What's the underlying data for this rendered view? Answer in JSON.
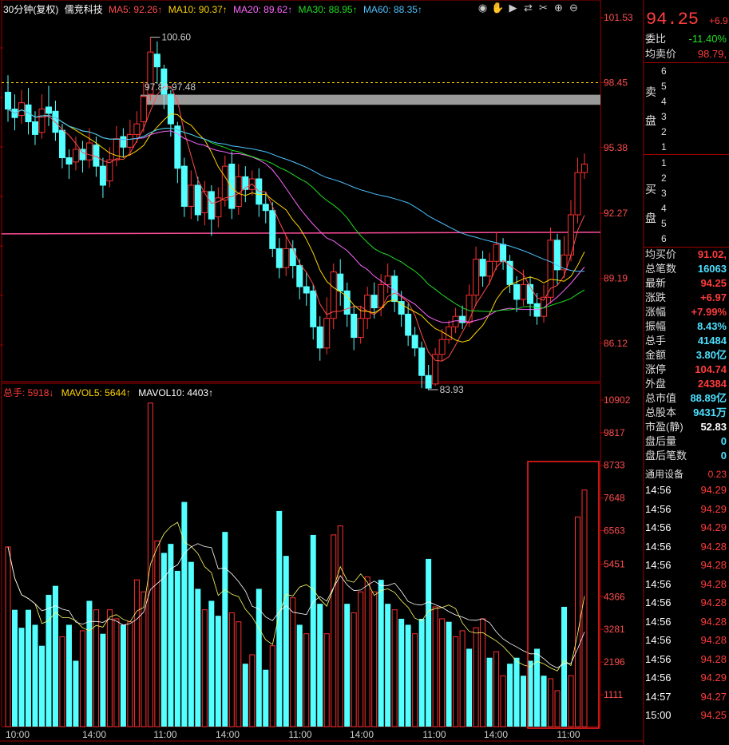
{
  "header": {
    "period": "30分钟(复权)",
    "stock": "儒竞科技",
    "ma": [
      {
        "label": "MA5: 92.26↑",
        "color": "#ff4d4d"
      },
      {
        "label": "MA10: 90.37↑",
        "color": "#ffd400"
      },
      {
        "label": "MA20: 89.62↑",
        "color": "#ff66ff"
      },
      {
        "label": "MA30: 88.95↑",
        "color": "#22dd22"
      },
      {
        "label": "MA60: 88.35↑",
        "color": "#4dc3ff"
      }
    ]
  },
  "toolbar": [
    "eye-icon",
    "hand-icon",
    "play-icon",
    "shuffle-icon",
    "tools-icon",
    "zoom-in-icon",
    "zoom-out-icon"
  ],
  "volume_header": {
    "zongshou": "总手: 5918↓",
    "mavol5": "MAVOL5: 5644↑",
    "mavol10": "MAVOL10: 4403↑"
  },
  "side": {
    "price": "94.25",
    "change_short": "+6.9",
    "weibi_label": "委比",
    "weibi": "-11.40%",
    "jmj_label": "均卖价",
    "jmj": "98.79,",
    "sell_label": "卖盘",
    "sell_levels": [
      "6",
      "5",
      "4",
      "3",
      "2",
      "1"
    ],
    "buy_label": "买盘",
    "buy_levels": [
      "1",
      "2",
      "3",
      "4",
      "5",
      "6"
    ],
    "stats": [
      {
        "k": "均买价",
        "v": "91.02,",
        "c": "red"
      },
      {
        "k": "总笔数",
        "v": "16063",
        "c": "cyan"
      },
      {
        "k": "最新",
        "v": "94.25",
        "c": "red"
      },
      {
        "k": "涨跌",
        "v": "+6.97",
        "c": "red"
      },
      {
        "k": "涨幅",
        "v": "+7.99%",
        "c": "red"
      },
      {
        "k": "振幅",
        "v": "8.43%",
        "c": "cyan"
      },
      {
        "k": "总手",
        "v": "41484",
        "c": "cyan"
      },
      {
        "k": "金额",
        "v": "3.80亿",
        "c": "cyan"
      },
      {
        "k": "涨停",
        "v": "104.74",
        "c": "red"
      },
      {
        "k": "外盘",
        "v": "24384",
        "c": "red"
      },
      {
        "k": "总市值",
        "v": "88.89亿",
        "c": "cyan"
      },
      {
        "k": "总股本",
        "v": "9431万",
        "c": "cyan"
      },
      {
        "k": "市盈(静)",
        "v": "52.83",
        "c": "wht"
      },
      {
        "k": "盘后量",
        "v": "0",
        "c": "cyan"
      },
      {
        "k": "盘后笔数",
        "v": "0",
        "c": "cyan"
      }
    ],
    "device_label": "通用设备",
    "device_val": "0.23",
    "ticks": [
      {
        "t": "14:56",
        "p": "94.29"
      },
      {
        "t": "14:56",
        "p": "94.29"
      },
      {
        "t": "14:56",
        "p": "94.29"
      },
      {
        "t": "14:56",
        "p": "94.28"
      },
      {
        "t": "14:56",
        "p": "94.28"
      },
      {
        "t": "14:56",
        "p": "94.28"
      },
      {
        "t": "14:56",
        "p": "94.28"
      },
      {
        "t": "14:56",
        "p": "94.28"
      },
      {
        "t": "14:56",
        "p": "94.28"
      },
      {
        "t": "14:56",
        "p": "94.28"
      },
      {
        "t": "14:56",
        "p": "94.29"
      },
      {
        "t": "14:57",
        "p": "94.27"
      },
      {
        "t": "15:00",
        "p": "94.25"
      }
    ]
  },
  "chart_data": {
    "type": "candlestick",
    "price_ticks": [
      "101.53",
      "98.45",
      "95.38",
      "92.27",
      "89.19",
      "86.12"
    ],
    "price_tick_values": [
      101.53,
      98.45,
      95.38,
      92.27,
      89.19,
      86.12
    ],
    "vol_ticks": [
      "10902",
      "9817",
      "8733",
      "7648",
      "6563",
      "5451",
      "4366",
      "3281",
      "2196",
      "1111"
    ],
    "vol_tick_values": [
      10902,
      9817,
      8733,
      7648,
      6563,
      5451,
      4366,
      3281,
      2196,
      1111
    ],
    "x_labels": [
      "10:00",
      "14:00",
      "11:00",
      "14:00",
      "11:00",
      "14:00",
      "11:00",
      "14:00",
      "11:00"
    ],
    "annot_high": "100.60",
    "annot_low": "83.93",
    "annot_range": "97.88-97.48",
    "ref_dashed": 98.45,
    "ref_line": 91.3,
    "band": [
      97.48,
      97.88
    ],
    "candles": [
      [
        98.0,
        97.2,
        98.8,
        96.6
      ],
      [
        97.2,
        96.8,
        97.9,
        96.2
      ],
      [
        96.9,
        97.5,
        98.1,
        96.5
      ],
      [
        97.4,
        96.6,
        98.2,
        96.0
      ],
      [
        96.6,
        96.0,
        97.1,
        95.5
      ],
      [
        96.1,
        97.2,
        97.9,
        95.8
      ],
      [
        97.3,
        97.0,
        98.3,
        96.4
      ],
      [
        97.1,
        96.1,
        97.6,
        95.7
      ],
      [
        96.2,
        94.9,
        96.5,
        94.4
      ],
      [
        94.9,
        94.6,
        95.3,
        93.9
      ],
      [
        94.7,
        95.3,
        95.9,
        94.3
      ],
      [
        95.3,
        94.8,
        95.7,
        94.2
      ],
      [
        94.8,
        95.6,
        96.3,
        94.4
      ],
      [
        95.5,
        94.5,
        95.9,
        94.0
      ],
      [
        94.5,
        93.6,
        94.9,
        93.0
      ],
      [
        93.8,
        94.8,
        95.4,
        93.5
      ],
      [
        94.8,
        95.8,
        96.4,
        94.5
      ],
      [
        95.9,
        95.4,
        96.3,
        94.9
      ],
      [
        95.4,
        96.0,
        96.7,
        95.0
      ],
      [
        96.0,
        96.5,
        97.1,
        95.6
      ],
      [
        96.6,
        97.8,
        98.5,
        96.1
      ],
      [
        97.9,
        99.9,
        100.6,
        97.6
      ],
      [
        99.8,
        99.2,
        100.4,
        98.4
      ],
      [
        99.1,
        97.9,
        99.3,
        97.2
      ],
      [
        97.9,
        96.5,
        98.1,
        95.9
      ],
      [
        96.4,
        94.4,
        96.6,
        93.7
      ],
      [
        94.5,
        92.6,
        94.9,
        92.1
      ],
      [
        92.6,
        93.6,
        94.3,
        92.0
      ],
      [
        93.6,
        92.2,
        94.0,
        91.9
      ],
      [
        92.3,
        93.3,
        93.8,
        91.7
      ],
      [
        93.3,
        92.0,
        93.6,
        91.2
      ],
      [
        92.1,
        93.0,
        93.5,
        91.6
      ],
      [
        92.9,
        94.5,
        95.0,
        92.6
      ],
      [
        94.6,
        92.5,
        95.2,
        92.0
      ],
      [
        92.6,
        94.0,
        94.6,
        92.2
      ],
      [
        94.0,
        93.4,
        94.5,
        92.8
      ],
      [
        93.4,
        93.9,
        94.3,
        93.1
      ],
      [
        93.9,
        92.7,
        94.4,
        92.1
      ],
      [
        92.7,
        92.4,
        93.3,
        91.8
      ],
      [
        92.4,
        90.6,
        92.8,
        90.2
      ],
      [
        90.6,
        89.7,
        91.1,
        89.2
      ],
      [
        89.7,
        90.6,
        91.2,
        89.3
      ],
      [
        90.6,
        89.8,
        91.0,
        89.2
      ],
      [
        89.8,
        88.8,
        90.1,
        88.2
      ],
      [
        88.8,
        88.5,
        89.5,
        87.9
      ],
      [
        88.6,
        86.9,
        88.9,
        86.3
      ],
      [
        86.9,
        85.9,
        87.4,
        85.3
      ],
      [
        85.9,
        87.3,
        88.3,
        85.6
      ],
      [
        87.3,
        89.5,
        89.9,
        86.8
      ],
      [
        89.4,
        88.6,
        90.1,
        87.9
      ],
      [
        88.6,
        87.5,
        89.0,
        86.9
      ],
      [
        87.5,
        86.4,
        87.9,
        85.8
      ],
      [
        86.4,
        87.3,
        87.9,
        86.1
      ],
      [
        87.3,
        88.4,
        88.8,
        86.8
      ],
      [
        88.4,
        87.8,
        89.0,
        87.3
      ],
      [
        87.8,
        88.9,
        89.4,
        87.4
      ],
      [
        88.9,
        89.3,
        89.9,
        88.5
      ],
      [
        89.3,
        88.1,
        89.6,
        87.6
      ],
      [
        88.1,
        87.5,
        88.6,
        86.9
      ],
      [
        87.5,
        86.5,
        88.0,
        86.0
      ],
      [
        86.5,
        85.9,
        86.9,
        85.5
      ],
      [
        85.9,
        84.6,
        86.2,
        84.0
      ],
      [
        84.6,
        84.0,
        85.1,
        83.9
      ],
      [
        84.2,
        85.6,
        85.9,
        84.1
      ],
      [
        85.6,
        86.3,
        86.8,
        85.3
      ],
      [
        86.3,
        86.9,
        87.2,
        86.1
      ],
      [
        86.9,
        87.4,
        87.8,
        86.6
      ],
      [
        87.4,
        87.1,
        87.9,
        86.8
      ],
      [
        87.1,
        88.4,
        88.9,
        86.9
      ],
      [
        88.4,
        90.1,
        90.7,
        87.9
      ],
      [
        90.1,
        89.3,
        90.5,
        88.8
      ],
      [
        89.3,
        90.0,
        90.4,
        88.9
      ],
      [
        90.0,
        90.8,
        91.4,
        89.6
      ],
      [
        90.8,
        90.0,
        91.1,
        89.6
      ],
      [
        90.0,
        88.9,
        90.3,
        88.5
      ],
      [
        88.9,
        88.2,
        89.3,
        87.6
      ],
      [
        88.2,
        88.9,
        89.6,
        87.9
      ],
      [
        88.9,
        88.0,
        89.3,
        87.4
      ],
      [
        88.0,
        87.4,
        88.5,
        87.0
      ],
      [
        87.4,
        88.3,
        88.9,
        87.1
      ],
      [
        88.3,
        91.0,
        91.6,
        88.0
      ],
      [
        91.0,
        89.6,
        91.3,
        88.9
      ],
      [
        89.6,
        90.3,
        91.2,
        89.2
      ],
      [
        90.3,
        92.2,
        92.9,
        90.0
      ],
      [
        92.2,
        94.2,
        94.9,
        91.8
      ],
      [
        94.2,
        94.6,
        95.1,
        93.9
      ]
    ],
    "volumes": [
      [
        6000,
        false
      ],
      [
        3900,
        true
      ],
      [
        3300,
        true
      ],
      [
        3900,
        true
      ],
      [
        3400,
        true
      ],
      [
        2700,
        true
      ],
      [
        4400,
        true
      ],
      [
        4700,
        true
      ],
      [
        3000,
        false
      ],
      [
        3400,
        true
      ],
      [
        2200,
        true
      ],
      [
        3200,
        false
      ],
      [
        4200,
        true
      ],
      [
        3900,
        false
      ],
      [
        3100,
        true
      ],
      [
        3900,
        false
      ],
      [
        3600,
        false
      ],
      [
        3400,
        true
      ],
      [
        3500,
        false
      ],
      [
        4900,
        false
      ],
      [
        4500,
        false
      ],
      [
        10800,
        false
      ],
      [
        6200,
        false
      ],
      [
        5800,
        true
      ],
      [
        6100,
        true
      ],
      [
        5200,
        true
      ],
      [
        7500,
        true
      ],
      [
        5500,
        true
      ],
      [
        4600,
        true
      ],
      [
        3900,
        false
      ],
      [
        4200,
        true
      ],
      [
        3700,
        true
      ],
      [
        6500,
        true
      ],
      [
        3800,
        false
      ],
      [
        3500,
        false
      ],
      [
        2100,
        true
      ],
      [
        2400,
        false
      ],
      [
        4600,
        true
      ],
      [
        1900,
        true
      ],
      [
        2700,
        false
      ],
      [
        7200,
        true
      ],
      [
        5700,
        true
      ],
      [
        4300,
        false
      ],
      [
        3400,
        true
      ],
      [
        3100,
        false
      ],
      [
        6400,
        true
      ],
      [
        4100,
        true
      ],
      [
        3100,
        false
      ],
      [
        6400,
        false
      ],
      [
        6700,
        false
      ],
      [
        4100,
        true
      ],
      [
        3800,
        false
      ],
      [
        4500,
        false
      ],
      [
        5000,
        false
      ],
      [
        4500,
        false
      ],
      [
        4900,
        true
      ],
      [
        4100,
        true
      ],
      [
        3900,
        false
      ],
      [
        3600,
        true
      ],
      [
        3400,
        true
      ],
      [
        3100,
        false
      ],
      [
        3600,
        true
      ],
      [
        5600,
        true
      ],
      [
        4000,
        false
      ],
      [
        3600,
        false
      ],
      [
        3500,
        true
      ],
      [
        3000,
        false
      ],
      [
        3200,
        false
      ],
      [
        2600,
        true
      ],
      [
        3300,
        false
      ],
      [
        3600,
        false
      ],
      [
        2300,
        true
      ],
      [
        2500,
        false
      ],
      [
        1700,
        false
      ],
      [
        2100,
        true
      ],
      [
        2300,
        true
      ],
      [
        1700,
        true
      ],
      [
        2200,
        true
      ],
      [
        2600,
        true
      ],
      [
        1700,
        true
      ],
      [
        1600,
        false
      ],
      [
        1200,
        false
      ],
      [
        4000,
        true
      ],
      [
        1700,
        false
      ],
      [
        7000,
        false
      ],
      [
        7900,
        false
      ]
    ]
  }
}
